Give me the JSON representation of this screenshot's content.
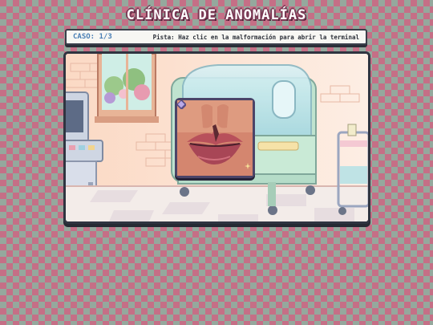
{
  "game": {
    "title": "CLÍNICA DE ANOMALÍAS",
    "case_label": "CASO: 1/3",
    "hint": "Pista: Haz clic en la malformación para abrir la terminal"
  },
  "colors": {
    "background_pink": "#c56f86",
    "background_sage": "#95a89d",
    "case_blue": "#4a7fb5",
    "incubator_mint": "#bfe3cf",
    "frame_purple": "#4b4468"
  },
  "icons": {
    "corner_ornament": "diamond-ornament-icon",
    "sparkle": "star-sparkle-icon"
  },
  "scene": {
    "room": "pixel-art hospital nursery",
    "featured_object": "incubator",
    "anomaly": "cleft-lip"
  }
}
